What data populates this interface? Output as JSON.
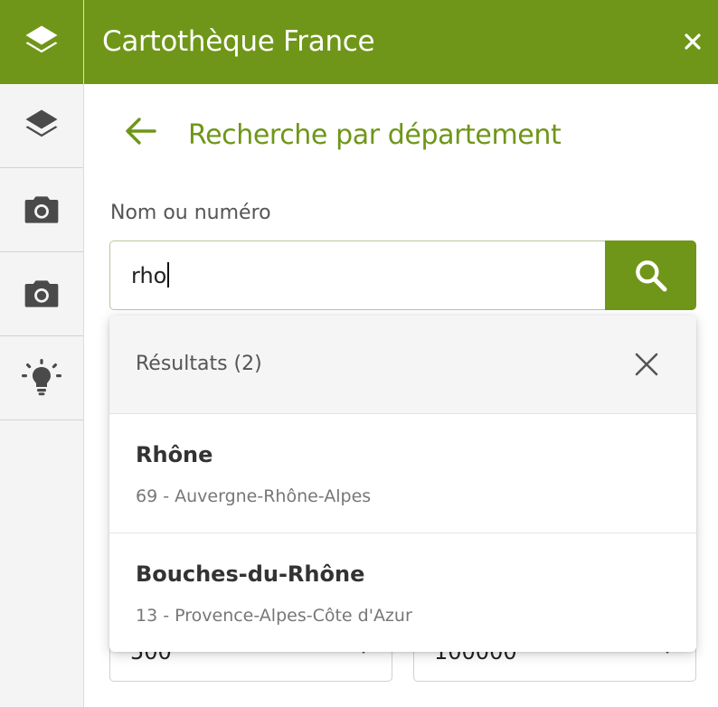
{
  "app": {
    "title": "Cartothèque France"
  },
  "rail": {
    "items": [
      {
        "icon": "layers-icon",
        "active": true
      },
      {
        "icon": "layers-icon",
        "active": false
      },
      {
        "icon": "camera-icon",
        "active": false
      },
      {
        "icon": "camera-icon",
        "active": false
      },
      {
        "icon": "lightbulb-icon",
        "active": false
      }
    ]
  },
  "page": {
    "title": "Recherche par département",
    "back_icon": "arrow-left-icon"
  },
  "search": {
    "label": "Nom ou numéro",
    "value": "rho",
    "button_icon": "search-icon"
  },
  "results": {
    "title": "Résultats (2)",
    "items": [
      {
        "name": "Rhône",
        "detail": "69 - Auvergne-Rhône-Alpes"
      },
      {
        "name": "Bouches-du-Rhône",
        "detail": "13 - Provence-Alpes-Côte d'Azur"
      }
    ]
  },
  "selects": {
    "left_value": "500",
    "right_value": "100000"
  },
  "colors": {
    "accent": "#6f9618",
    "rail_bg": "#f4f4f4",
    "icon_gray": "#4a4a4a"
  }
}
